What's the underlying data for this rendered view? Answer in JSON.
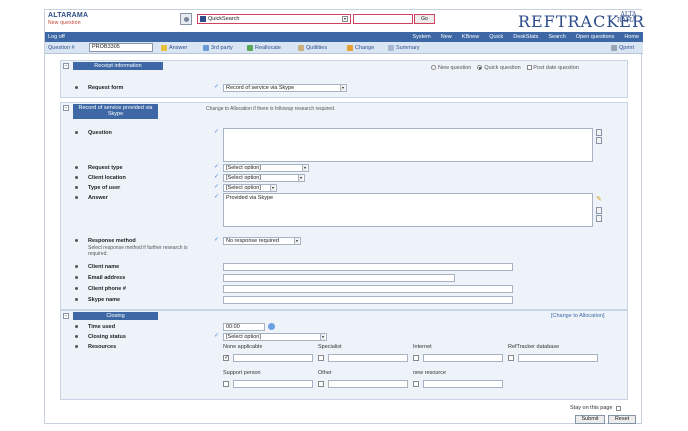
{
  "brand": {
    "name": "ALTARAMA",
    "subtitle": "New question"
  },
  "quicksearch": {
    "selected": "QuickSearch",
    "go_label": "Go"
  },
  "logo": {
    "text": "REFTRACKER",
    "small_top": "ALTA",
    "small_bottom": "RAMA"
  },
  "nav": {
    "logoff": "Log off",
    "links": [
      "System",
      "New",
      "KBnew",
      "Quick",
      "DeskStats",
      "Search",
      "Open questions",
      "Home"
    ]
  },
  "toolbar": {
    "question_label": "Question #",
    "question_value": "PROB3305",
    "items": [
      "Answer",
      "3rd party",
      "Reallocate",
      "Qutilities",
      "Change",
      "Summary"
    ],
    "print_label": "Qprint"
  },
  "receipt": {
    "title": "Receipt information",
    "request_form_label": "Request form",
    "request_form_value": "Record of service via Skype",
    "radio_new": "New question",
    "radio_quick": "Quick question",
    "post_date": "Post date question"
  },
  "record": {
    "title": "Record of service provided via Skype",
    "notice": "Change to Allocation if there is followup research required.",
    "question_label": "Question",
    "request_type_label": "Request type",
    "request_type_value": "[Select option]",
    "client_location_label": "Client location",
    "client_location_value": "[Select option]",
    "type_of_user_label": "Type of user",
    "type_of_user_value": "[Select option]",
    "answer_label": "Answer",
    "answer_value": "Provided via Skype",
    "response_method_label": "Response method",
    "response_method_note": "Select response method if further research is required.",
    "response_method_value": "No response required",
    "client_name_label": "Client name",
    "email_label": "Email address",
    "phone_label": "Client phone #",
    "skype_label": "Skype name"
  },
  "closing": {
    "title": "Closing",
    "change_link": "[Change to Allocation]",
    "time_used_label": "Time used",
    "time_used_value": "00:00",
    "closing_status_label": "Closing status",
    "closing_status_value": "[Select option]",
    "resources_label": "Resources",
    "resources": [
      "None applicable",
      "Specialist",
      "Internet",
      "RefTracker database",
      "Support person",
      "Other",
      "new resource"
    ]
  },
  "footer": {
    "stay_label": "Stay on this page",
    "submit_label": "Submit",
    "reset_label": "Reset"
  },
  "colors": {
    "nav_bg": "#3d68a5",
    "toolbar_bg": "#d9e5f3",
    "section_bg": "#eef3fa",
    "highlight": "#d04060",
    "brand": "#2c4d8a"
  }
}
